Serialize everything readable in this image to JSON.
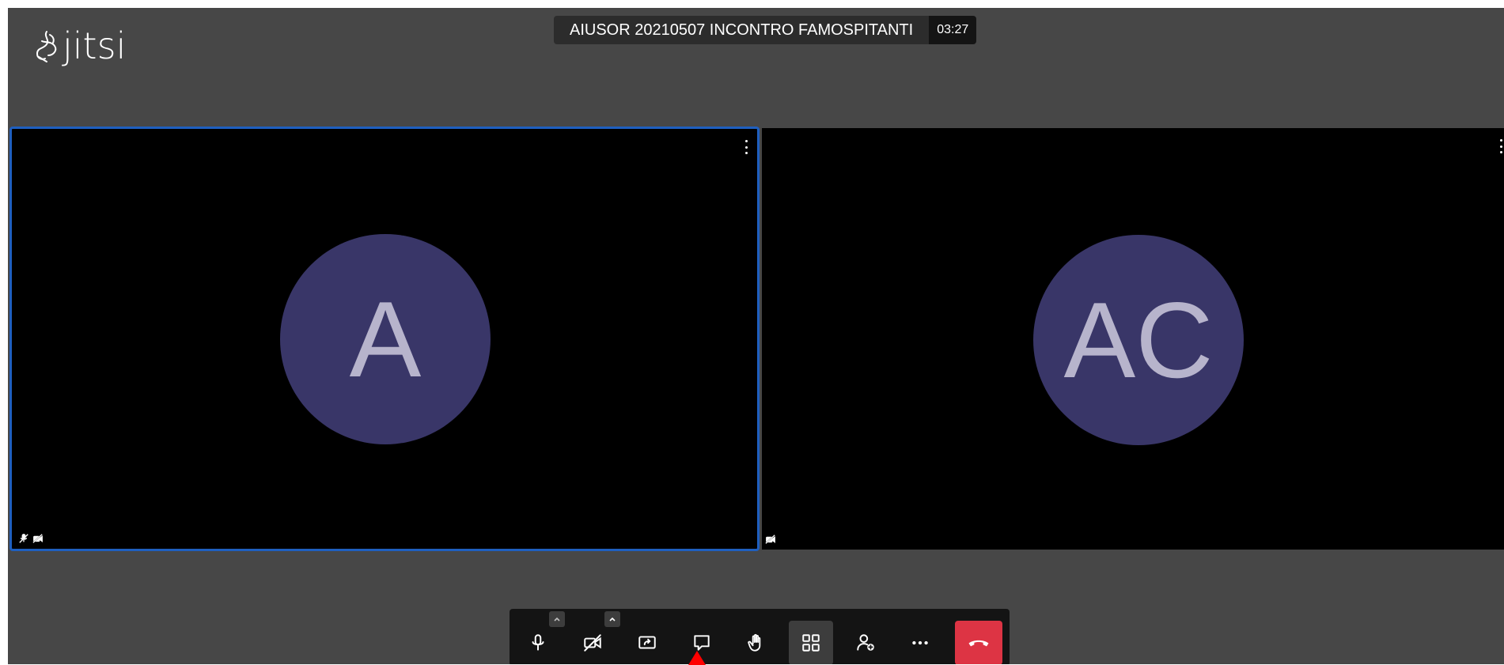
{
  "app": {
    "logo_text": "jitsi",
    "colors": {
      "stage_background": "#474747",
      "tile_background": "#000000",
      "active_border": "#1f5fbf",
      "avatar_fill": "#393668",
      "hangup": "#dd3444",
      "annotation_arrow": "#ff0000"
    }
  },
  "subject": {
    "title": "AIUSOR 20210507 INCONTRO FAMOSPITANTI",
    "timer": "03:27"
  },
  "tiles": [
    {
      "initials": "A",
      "active": true,
      "indicators": [
        "mic-muted-icon",
        "camera-off-icon"
      ],
      "menu_icon": "kebab-menu-icon"
    },
    {
      "initials": "AC",
      "active": false,
      "indicators": [
        "camera-off-icon"
      ],
      "menu_icon": "kebab-menu-icon"
    }
  ],
  "toolbar": {
    "buttons": [
      {
        "icon": "microphone-icon",
        "has_options": true
      },
      {
        "icon": "camera-off-icon",
        "has_options": true
      },
      {
        "icon": "share-screen-icon"
      },
      {
        "icon": "chat-icon"
      },
      {
        "icon": "raise-hand-icon"
      },
      {
        "icon": "tile-view-icon",
        "toggled": true
      },
      {
        "icon": "invite-people-icon"
      },
      {
        "icon": "more-options-icon"
      },
      {
        "icon": "hangup-icon"
      }
    ]
  }
}
